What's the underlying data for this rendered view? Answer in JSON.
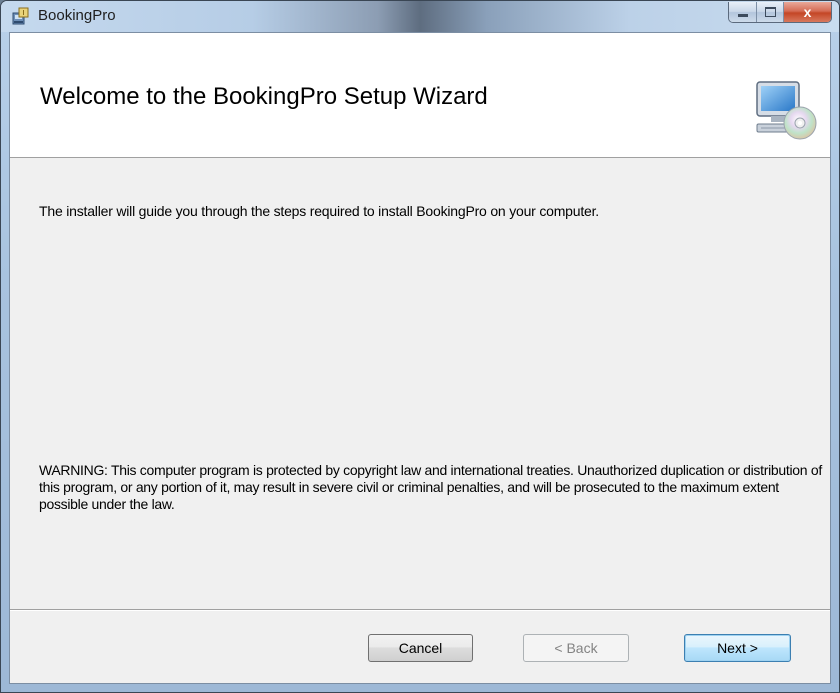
{
  "window": {
    "title": "BookingPro",
    "controls": {
      "minimize": "minimize",
      "maximize": "maximize",
      "close": "x"
    }
  },
  "banner": {
    "heading": "Welcome to the BookingPro Setup Wizard",
    "icon": "computer-cd-icon"
  },
  "body": {
    "intro": "The installer will guide you through the steps required to install BookingPro on your computer.",
    "warning": "WARNING: This computer program is protected by copyright law and international treaties. Unauthorized duplication or distribution of this program, or any portion of it, may result in severe civil or criminal penalties, and will be prosecuted to the maximum extent possible under the law."
  },
  "buttons": {
    "cancel": "Cancel",
    "back": "< Back",
    "next": "Next >"
  },
  "colors": {
    "title_bar": "#b9d1ea",
    "client_background": "#f0f0f0",
    "banner_background": "#ffffff",
    "close_button": "#c44626",
    "default_button_border": "#3c7fb1"
  }
}
